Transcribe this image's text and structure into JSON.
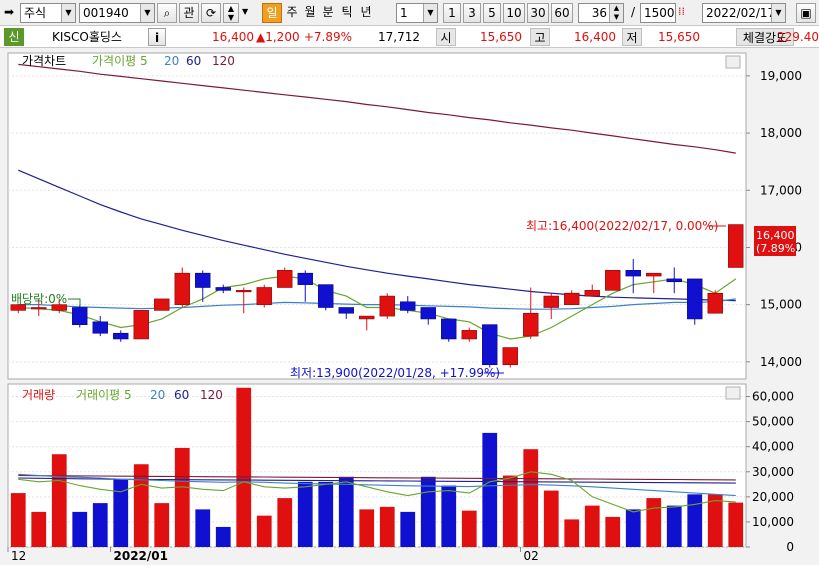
{
  "toolbar": {
    "market": "주식",
    "code": "001940",
    "chart_btn": "관",
    "period_active": "일",
    "periods": [
      "주",
      "월",
      "분",
      "틱",
      "년"
    ],
    "interval_value": "1",
    "interval_buttons": [
      "1",
      "3",
      "5",
      "10",
      "30",
      "60"
    ],
    "count": "36",
    "slash": "/",
    "total": "1500",
    "date": "2022/02/17"
  },
  "info": {
    "tag": "신",
    "name": "KISCO홀딩스",
    "i_btn": "i",
    "price": "16,400",
    "change": "▲1,200",
    "change_pct": "+7.89%",
    "volume": "17,712",
    "open_label": "시",
    "open": "15,650",
    "high_label": "고",
    "high": "16,400",
    "low_label": "저",
    "low": "15,650",
    "strength_label": "체결강도",
    "strength": "229.40"
  },
  "colors": {
    "up": "#e01010",
    "down": "#1010d0",
    "ma5": "#6aa52c",
    "ma20": "#3c82c8",
    "ma60": "#202090",
    "ma120": "#7a1a3a"
  },
  "chart_data": [
    {
      "type": "candlestick",
      "legend": [
        "가격차트",
        "가격이평 5",
        "20",
        "60",
        "120"
      ],
      "ylim": [
        13700,
        19400
      ],
      "y_ticks": [
        "14,000",
        "15,000",
        "16,000",
        "17,000",
        "18,000",
        "19,000"
      ],
      "x_labels": [
        "12",
        "2022/01",
        "02"
      ],
      "x_label_index": [
        0,
        5,
        25
      ],
      "candles": [
        {
          "o": 14900,
          "h": 15000,
          "l": 14850,
          "c": 15000
        },
        {
          "o": 14950,
          "h": 15100,
          "l": 14800,
          "c": 14950
        },
        {
          "o": 14900,
          "h": 15100,
          "l": 14850,
          "c": 15000
        },
        {
          "o": 14950,
          "h": 15000,
          "l": 14600,
          "c": 14650
        },
        {
          "o": 14700,
          "h": 14800,
          "l": 14450,
          "c": 14500
        },
        {
          "o": 14500,
          "h": 14550,
          "l": 14350,
          "c": 14400
        },
        {
          "o": 14400,
          "h": 14900,
          "l": 14400,
          "c": 14900
        },
        {
          "o": 14900,
          "h": 15100,
          "l": 14900,
          "c": 15100
        },
        {
          "o": 15000,
          "h": 15650,
          "l": 14950,
          "c": 15550
        },
        {
          "o": 15550,
          "h": 15600,
          "l": 15050,
          "c": 15300
        },
        {
          "o": 15300,
          "h": 15350,
          "l": 15200,
          "c": 15250
        },
        {
          "o": 15250,
          "h": 15300,
          "l": 14850,
          "c": 15250
        },
        {
          "o": 15000,
          "h": 15350,
          "l": 14950,
          "c": 15300
        },
        {
          "o": 15300,
          "h": 15650,
          "l": 15300,
          "c": 15600
        },
        {
          "o": 15550,
          "h": 15600,
          "l": 15050,
          "c": 15350
        },
        {
          "o": 15350,
          "h": 15350,
          "l": 14900,
          "c": 14950
        },
        {
          "o": 14950,
          "h": 14950,
          "l": 14750,
          "c": 14850
        },
        {
          "o": 14750,
          "h": 14800,
          "l": 14550,
          "c": 14800
        },
        {
          "o": 14800,
          "h": 15200,
          "l": 14750,
          "c": 15150
        },
        {
          "o": 15050,
          "h": 15150,
          "l": 14850,
          "c": 14900
        },
        {
          "o": 14950,
          "h": 14950,
          "l": 14650,
          "c": 14750
        },
        {
          "o": 14750,
          "h": 14750,
          "l": 14350,
          "c": 14400
        },
        {
          "o": 14400,
          "h": 14600,
          "l": 14350,
          "c": 14550
        },
        {
          "o": 14650,
          "h": 14650,
          "l": 13900,
          "c": 13950
        },
        {
          "o": 13950,
          "h": 14250,
          "l": 13900,
          "c": 14250
        },
        {
          "o": 14450,
          "h": 15300,
          "l": 14400,
          "c": 14850
        },
        {
          "o": 14950,
          "h": 15200,
          "l": 14750,
          "c": 15150
        },
        {
          "o": 15000,
          "h": 15250,
          "l": 15000,
          "c": 15200
        },
        {
          "o": 15150,
          "h": 15350,
          "l": 15150,
          "c": 15250
        },
        {
          "o": 15250,
          "h": 15600,
          "l": 15250,
          "c": 15600
        },
        {
          "o": 15600,
          "h": 15800,
          "l": 15200,
          "c": 15500
        },
        {
          "o": 15500,
          "h": 15550,
          "l": 15200,
          "c": 15550
        },
        {
          "o": 15450,
          "h": 15650,
          "l": 15200,
          "c": 15400
        },
        {
          "o": 15450,
          "h": 15450,
          "l": 14650,
          "c": 14750
        },
        {
          "o": 14850,
          "h": 15250,
          "l": 14850,
          "c": 15200
        },
        {
          "o": 15650,
          "h": 16400,
          "l": 15650,
          "c": 16400
        }
      ],
      "ma5": [
        14950,
        14930,
        14900,
        14820,
        14700,
        14600,
        14650,
        14750,
        14950,
        15100,
        15300,
        15350,
        15450,
        15500,
        15450,
        15250,
        15150,
        14950,
        14950,
        14900,
        14850,
        14750,
        14700,
        14500,
        14400,
        14450,
        14600,
        14800,
        15000,
        15200,
        15350,
        15400,
        15450,
        15350,
        15200,
        15450
      ],
      "ma20": [
        15000,
        15000,
        14980,
        14960,
        14950,
        14940,
        14930,
        14940,
        14950,
        14970,
        14990,
        15000,
        15020,
        15040,
        15030,
        15020,
        15010,
        15000,
        15000,
        14990,
        14980,
        14970,
        14960,
        14940,
        14930,
        14920,
        14920,
        14930,
        14950,
        14970,
        15000,
        15020,
        15040,
        15040,
        15050,
        15100
      ],
      "ma60": [
        17350,
        17200,
        17050,
        16900,
        16750,
        16620,
        16500,
        16400,
        16300,
        16210,
        16120,
        16040,
        15960,
        15880,
        15810,
        15740,
        15670,
        15610,
        15550,
        15500,
        15450,
        15400,
        15350,
        15310,
        15270,
        15230,
        15200,
        15170,
        15150,
        15130,
        15120,
        15110,
        15100,
        15090,
        15080,
        15070
      ],
      "ma120": [
        19200,
        19160,
        19120,
        19080,
        19030,
        18990,
        18950,
        18910,
        18870,
        18830,
        18790,
        18750,
        18710,
        18670,
        18630,
        18590,
        18550,
        18500,
        18460,
        18410,
        18360,
        18320,
        18270,
        18230,
        18180,
        18140,
        18090,
        18050,
        18000,
        17950,
        17900,
        17850,
        17800,
        17760,
        17710,
        17650
      ],
      "annotations": {
        "max": "최고:16,400(2022/02/17, 0.00%)",
        "min": "최저:13,900(2022/01/28, +17.99%)",
        "dividend": "배당락:0%",
        "last_price": "16,400",
        "last_pct": "(7.89%)"
      }
    },
    {
      "type": "bar",
      "legend": [
        "거래량",
        "거래이평 5",
        "20",
        "60",
        "120"
      ],
      "ylim": [
        0,
        65000
      ],
      "y_ticks": [
        "0",
        "10,000",
        "20,000",
        "30,000",
        "40,000",
        "50,000",
        "60,000"
      ],
      "volumes": [
        21500,
        14000,
        37000,
        14000,
        17500,
        27000,
        33000,
        17500,
        39500,
        15000,
        8000,
        63500,
        12500,
        19500,
        26000,
        26000,
        28000,
        15000,
        16000,
        14000,
        28000,
        24500,
        14500,
        45500,
        28500,
        39000,
        22500,
        11000,
        16500,
        12000,
        15000,
        19500,
        16500,
        21000,
        21000,
        17712
      ],
      "vma5": [
        27000,
        26000,
        26500,
        24500,
        23000,
        22000,
        25000,
        23500,
        24000,
        23000,
        22500,
        26000,
        24000,
        23500,
        24000,
        25000,
        26000,
        24000,
        22000,
        20500,
        22000,
        22500,
        21500,
        26000,
        27500,
        30000,
        29000,
        26500,
        20000,
        17000,
        14000,
        15500,
        16000,
        17000,
        18500,
        18000
      ],
      "vma20": [
        29000,
        28500,
        28000,
        27800,
        27500,
        27000,
        26800,
        26500,
        26200,
        26000,
        25800,
        26000,
        25800,
        25500,
        25300,
        25100,
        25000,
        24800,
        24600,
        24400,
        24300,
        24200,
        24100,
        24400,
        24600,
        24900,
        24700,
        24400,
        24000,
        23500,
        23000,
        22500,
        22000,
        21500,
        21000,
        20500
      ],
      "vma60": [
        27500,
        27400,
        27300,
        27200,
        27100,
        27000,
        26950,
        26900,
        26850,
        26800,
        26750,
        26700,
        26650,
        26600,
        26550,
        26500,
        26450,
        26400,
        26350,
        26300,
        26250,
        26200,
        26150,
        26100,
        26050,
        26000,
        25950,
        25900,
        25850,
        25800,
        25750,
        25700,
        25650,
        25600,
        25550,
        25500
      ],
      "vma120": [
        28500,
        28450,
        28400,
        28350,
        28300,
        28250,
        28200,
        28150,
        28100,
        28050,
        28000,
        27950,
        27900,
        27850,
        27800,
        27750,
        27700,
        27650,
        27600,
        27550,
        27500,
        27450,
        27400,
        27350,
        27300,
        27250,
        27200,
        27150,
        27100,
        27050,
        27000,
        26950,
        26900,
        26850,
        26800,
        26750
      ]
    }
  ]
}
